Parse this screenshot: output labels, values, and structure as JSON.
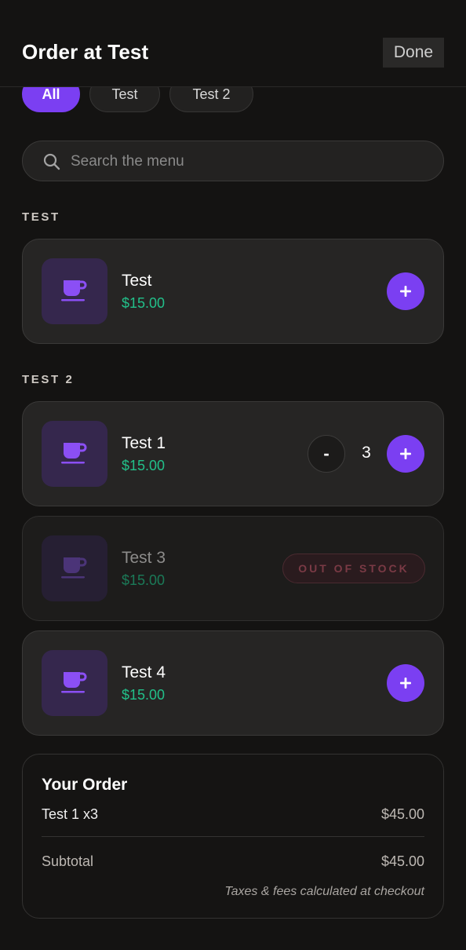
{
  "header": {
    "title": "Order at Test",
    "done_label": "Done"
  },
  "filters": [
    {
      "label": "All",
      "active": true
    },
    {
      "label": "Test",
      "active": false
    },
    {
      "label": "Test 2",
      "active": false
    }
  ],
  "search": {
    "placeholder": "Search the menu",
    "icon": "search-icon"
  },
  "sections": [
    {
      "label": "TEST",
      "items": [
        {
          "name": "Test",
          "price": "$15.00",
          "icon": "coffee-cup-icon",
          "state": "add"
        }
      ]
    },
    {
      "label": "TEST 2",
      "items": [
        {
          "name": "Test 1",
          "price": "$15.00",
          "icon": "coffee-cup-icon",
          "state": "in-cart",
          "quantity": "3",
          "minus_label": "-"
        },
        {
          "name": "Test 3",
          "price": "$15.00",
          "icon": "coffee-cup-icon",
          "state": "out-of-stock",
          "badge": "OUT OF STOCK"
        },
        {
          "name": "Test 4",
          "price": "$15.00",
          "icon": "coffee-cup-icon",
          "state": "add"
        }
      ]
    }
  ],
  "order": {
    "title": "Your Order",
    "lines": [
      {
        "label": "Test 1 x3",
        "amount": "$45.00"
      }
    ],
    "subtotal_label": "Subtotal",
    "subtotal_amount": "$45.00",
    "note": "Taxes & fees calculated at checkout"
  },
  "colors": {
    "accent": "#7b3ff2",
    "price": "#22c08a",
    "background": "#141312",
    "card": "#262524",
    "out_of_stock": "#7a3a45"
  }
}
